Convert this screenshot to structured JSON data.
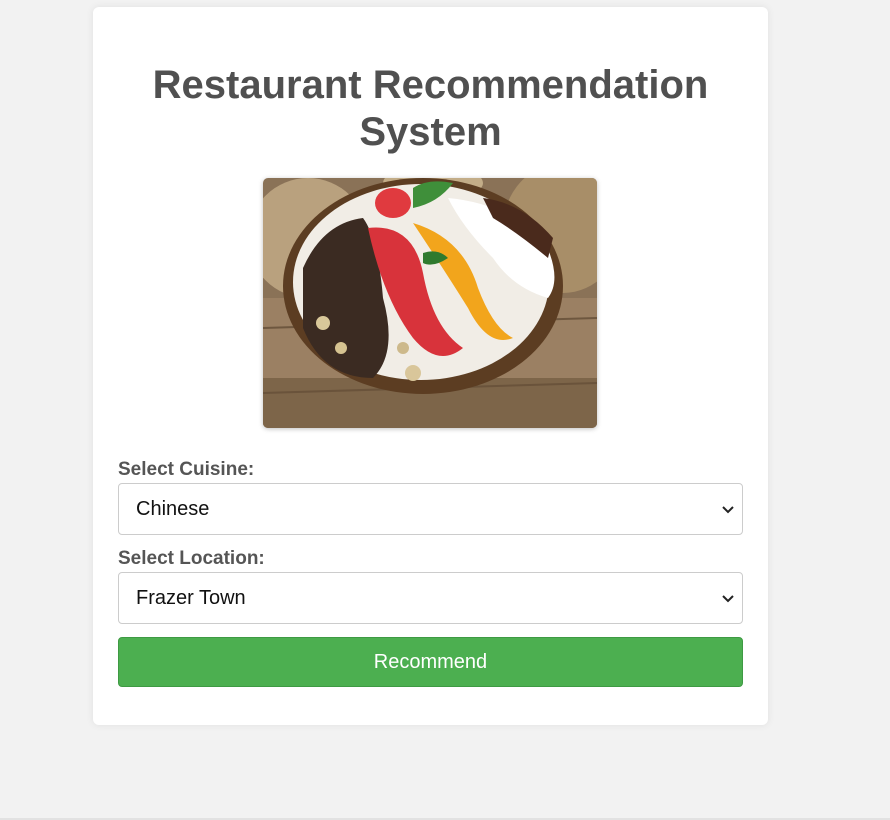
{
  "page": {
    "title": "Restaurant Recommendation System"
  },
  "image": {
    "description_icon": "food-bowl-photo"
  },
  "form": {
    "cuisine_label": "Select Cuisine:",
    "cuisine_value": "Chinese",
    "location_label": "Select Location:",
    "location_value": "Frazer Town",
    "submit_label": "Recommend"
  },
  "colors": {
    "background": "#f2f2f2",
    "card": "#ffffff",
    "title": "#505050",
    "label": "#555555",
    "button": "#4caf50",
    "button_text": "#ffffff"
  }
}
